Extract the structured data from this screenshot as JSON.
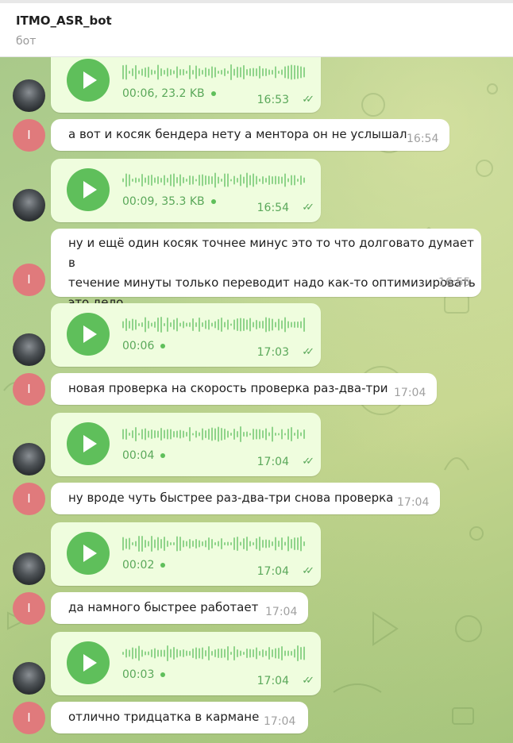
{
  "header": {
    "title": "ITMO_ASR_bot",
    "subtitle": "бот"
  },
  "user_avatar_letter": "I",
  "messages": [
    {
      "kind": "voice",
      "duration": "00:06, 23.2 KB",
      "time": "16:53"
    },
    {
      "kind": "text",
      "text": "а вот и косяк бендера нету а ментора он не услышал",
      "time": "16:54"
    },
    {
      "kind": "voice",
      "duration": "00:09, 35.3 KB",
      "time": "16:54"
    },
    {
      "kind": "text",
      "lines": [
        "ну и ещё один косяк точнее минус это то что долговато думает в",
        "течение минуты только переводит надо как-то оптимизировать",
        "это дело"
      ],
      "time": "16:55"
    },
    {
      "kind": "voice",
      "duration": "00:06",
      "time": "17:03"
    },
    {
      "kind": "text",
      "text": "новая проверка на скорость проверка раз-два-три",
      "time": "17:04"
    },
    {
      "kind": "voice",
      "duration": "00:04",
      "time": "17:04"
    },
    {
      "kind": "text",
      "text": "ну вроде чуть быстрее раз-два-три снова проверка",
      "time": "17:04"
    },
    {
      "kind": "voice",
      "duration": "00:02",
      "time": "17:04"
    },
    {
      "kind": "text",
      "text": "да намного быстрее работает",
      "time": "17:04"
    },
    {
      "kind": "voice",
      "duration": "00:03",
      "time": "17:04"
    },
    {
      "kind": "text",
      "text": "отлично тридцатка в кармане",
      "time": "17:04"
    }
  ],
  "colors": {
    "outgoing_bubble": "#effdde",
    "accent_green": "#5fbf5b",
    "avatar_red": "#e07a7c"
  }
}
